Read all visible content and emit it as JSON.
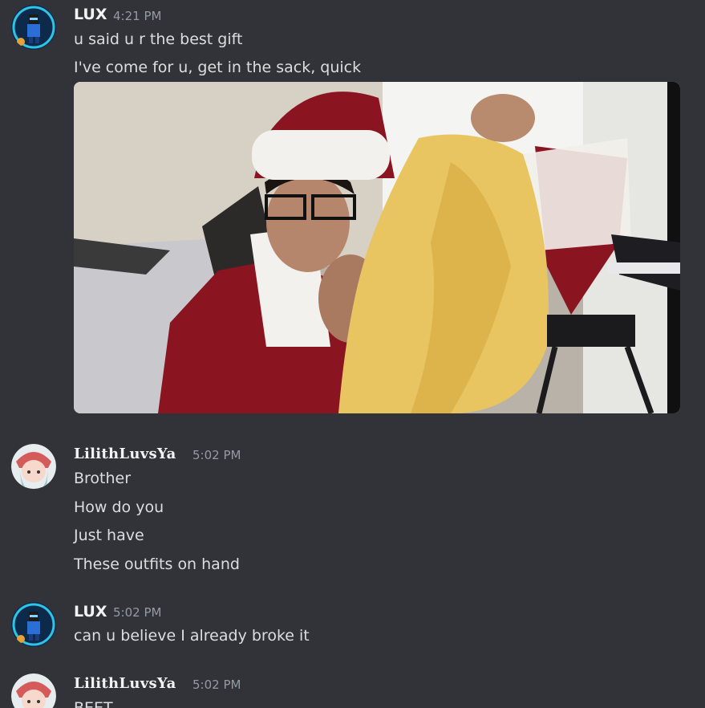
{
  "messages": [
    {
      "author": "LUX",
      "time": "4:21 PM",
      "lines": [
        "u said u r the best gift",
        "I've come for u, get in the sack, quick"
      ],
      "has_image": true
    },
    {
      "author": "LilithLuvsYa",
      "time": "5:02 PM",
      "lines": [
        "Brother",
        "How do you",
        "Just have",
        "These outfits on hand"
      ]
    },
    {
      "author": "LUX",
      "time": "5:02 PM",
      "lines": [
        "can u believe I already broke it"
      ]
    },
    {
      "author": "LilithLuvsYa",
      "time": "5:02 PM",
      "lines": [
        "BEET"
      ]
    }
  ],
  "colors": {
    "background": "#313338",
    "username": "#f2f3f5",
    "timestamp": "#949ba4",
    "text": "#dbdee1"
  }
}
